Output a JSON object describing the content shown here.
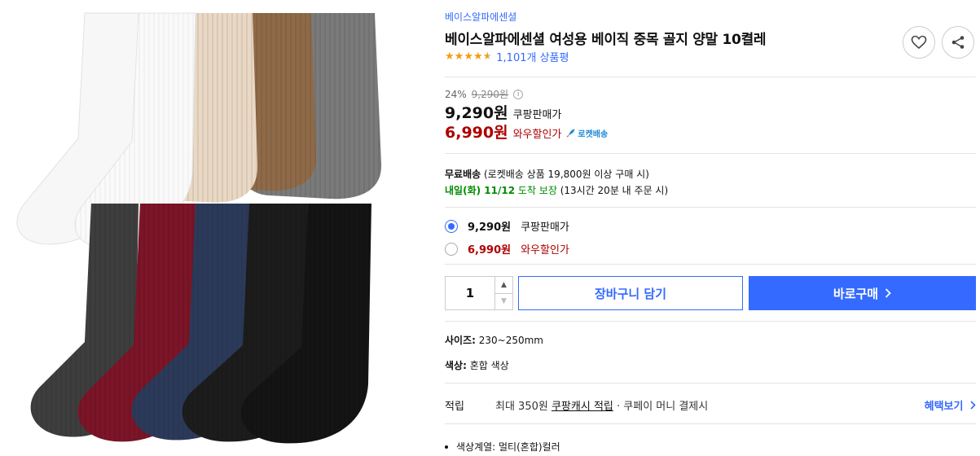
{
  "product": {
    "brand": "베이스알파에센셜",
    "title": "베이스알파에센셜 여성용 베이직 중목 골지 양말 10켤레",
    "rating": 4.5,
    "review_count": "1,101개 상품평"
  },
  "pricing": {
    "discount": "24%",
    "original_price": "9,290원",
    "price": "9,290원",
    "price_label": "쿠팡판매가",
    "wow_price": "6,990원",
    "wow_label": "와우할인가",
    "rocket_badge": "로켓배송"
  },
  "shipping": {
    "free_label": "무료배송",
    "free_detail": "(로켓배송 상품 19,800원 이상 구매 시)",
    "arrival_date": "내일(화) 11/12",
    "arrival_guarantee": "도착 보장",
    "arrival_note": "(13시간 20분 내 주문 시)"
  },
  "options": [
    {
      "price": "9,290원",
      "label": "쿠팡판매가",
      "selected": true
    },
    {
      "price": "6,990원",
      "label": "와우할인가",
      "selected": false
    }
  ],
  "purchase": {
    "quantity": "1",
    "cart_label": "장바구니 담기",
    "buy_label": "바로구매"
  },
  "attributes": {
    "size_label": "사이즈:",
    "size_value": "230~250mm",
    "color_label": "색상:",
    "color_value": "혼합 색상"
  },
  "reward": {
    "label": "적립",
    "text_prefix": "최대 350원",
    "link_text": "쿠팡캐시 적립",
    "text_suffix": "· 쿠페이 머니 결제시",
    "benefit_link": "혜택보기"
  },
  "details": [
    "색상계열: 멀티(혼합)컬러"
  ],
  "colors": {
    "accent": "#346aff",
    "wow_red": "#ae0000",
    "rating_orange": "#f39c12",
    "guarantee_green": "#008c00"
  },
  "icons": [
    "heart-icon",
    "share-icon",
    "info-icon",
    "rocket-icon",
    "chevron-right-icon",
    "caret-up-icon",
    "caret-down-icon"
  ]
}
